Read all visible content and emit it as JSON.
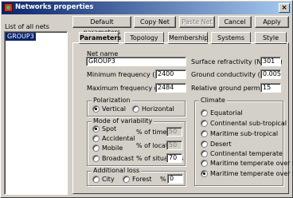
{
  "window": {
    "title": "Networks properties",
    "close_glyph": "×"
  },
  "toolbar": {
    "default_parameters": "Default parameters",
    "copy_net": "Copy Net",
    "paste_net": "Paste Net",
    "cancel": "Cancel",
    "apply": "Apply"
  },
  "net_list": {
    "label": "List of all nets",
    "items": [
      "GROUP3"
    ]
  },
  "tabs": [
    "Parameters",
    "Topology",
    "Membership",
    "Systems",
    "Style"
  ],
  "params": {
    "net_name_label": "Net name",
    "net_name_value": "GROUP3",
    "min_freq_label": "Minimum frequency (MHz)",
    "min_freq_value": "2400",
    "max_freq_label": "Maximum frequency (MHz)",
    "max_freq_value": "2484",
    "refractivity_label": "Surface refractivity (N-Units)",
    "refractivity_value": "301",
    "conductivity_label": "Ground conductivity (S/m)",
    "conductivity_value": "0.005",
    "permittivity_label": "Relative ground permittivity",
    "permittivity_value": "15"
  },
  "polarization": {
    "label": "Polarization",
    "options": [
      "Vertical",
      "Horizontal"
    ],
    "selected": "Vertical"
  },
  "variability": {
    "label": "Mode of variability",
    "options": [
      "Spot",
      "Accidental",
      "Mobile",
      "Broadcast"
    ],
    "selected": "Spot",
    "time_label": "% of time",
    "time_value": "50",
    "locations_label": "% of locations",
    "locations_value": "50",
    "situations_label": "% of situations",
    "situations_value": "70"
  },
  "additional_loss": {
    "label": "Additional loss",
    "options": [
      "City",
      "Forest"
    ],
    "percent_label": "%",
    "percent_value": "0"
  },
  "climate": {
    "label": "Climate",
    "options": [
      "Equatorial",
      "Continental sub-tropical",
      "Maritime sub-tropical",
      "Desert",
      "Continental temperate",
      "Maritime temperate over land",
      "Maritime temperate over sea"
    ],
    "selected": "Maritime temperate over sea"
  }
}
